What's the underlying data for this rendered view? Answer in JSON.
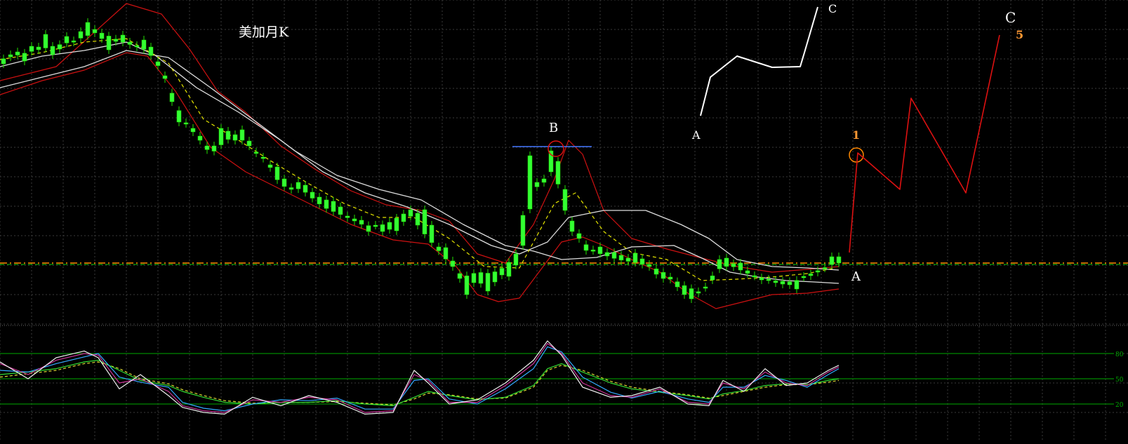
{
  "chart_data": {
    "type": "candlestick",
    "title": "美加月K",
    "grid": true,
    "background": "#000000",
    "colors": {
      "candle": "#22e000",
      "ma_white": "#dddddd",
      "ma_red": "#cc1111",
      "ma_yellow": "#e5e500",
      "bar_up": "#33ff33",
      "grid": "#3a3a3a",
      "ref_orange": "#ff8800",
      "ref_green": "#00cc00",
      "annot_white": "#ffffff",
      "annot_red": "#dd1111",
      "annot_orange": "#ff9933",
      "annot_blue": "#4477ff",
      "osc_white": "#eeeeee",
      "osc_magenta": "#cc3399",
      "osc_cyan": "#33aaff",
      "osc_green": "#33dd33",
      "osc_yellow": "#dddd33"
    },
    "main_panel": {
      "ylim": [
        0,
        470
      ],
      "price_x": [
        0,
        50,
        100,
        140,
        175,
        210,
        235,
        260,
        285,
        300,
        320,
        335,
        355,
        380,
        400,
        430,
        460,
        490,
        520,
        550,
        580,
        610,
        640,
        660,
        680,
        700,
        720,
        745,
        760,
        775,
        790,
        800,
        815,
        830,
        850,
        880,
        910,
        940,
        970,
        1000,
        1020,
        1040,
        1070,
        1100,
        1130,
        1160,
        1190
      ],
      "price_close": [
        385,
        398,
        410,
        425,
        410,
        398,
        362,
        300,
        270,
        250,
        268,
        278,
        262,
        240,
        205,
        200,
        175,
        162,
        148,
        150,
        168,
        130,
        95,
        75,
        82,
        80,
        90,
        120,
        198,
        215,
        230,
        185,
        140,
        125,
        110,
        100,
        95,
        85,
        65,
        52,
        85,
        92,
        78,
        70,
        68,
        82,
        95
      ],
      "yellow_ma_x": [
        0,
        60,
        120,
        180,
        240,
        290,
        340,
        390,
        440,
        490,
        540,
        590,
        640,
        690,
        740,
        790,
        820,
        860,
        900,
        950,
        1000,
        1050,
        1100,
        1150,
        1190
      ],
      "yellow_ma_y": [
        385,
        395,
        410,
        415,
        380,
        300,
        270,
        238,
        208,
        180,
        160,
        160,
        130,
        90,
        88,
        180,
        195,
        140,
        110,
        100,
        70,
        72,
        75,
        80,
        88
      ],
      "white_ma1_x": [
        0,
        60,
        120,
        180,
        240,
        300,
        360,
        420,
        480,
        540,
        600,
        660,
        720,
        760,
        800,
        850,
        900,
        960,
        1000,
        1040,
        1080,
        1120,
        1160,
        1195
      ],
      "white_ma1_y": [
        345,
        360,
        375,
        398,
        388,
        345,
        300,
        255,
        220,
        200,
        185,
        150,
        120,
        112,
        100,
        103,
        118,
        120,
        102,
        82,
        75,
        70,
        68,
        66
      ],
      "white_ma2_x": [
        0,
        60,
        120,
        180,
        220,
        280,
        340,
        400,
        460,
        520,
        580,
        640,
        700,
        740,
        780,
        810,
        860,
        920,
        970,
        1010,
        1050,
        1100,
        1150,
        1195
      ],
      "white_ma2_y": [
        375,
        390,
        398,
        410,
        392,
        345,
        310,
        270,
        225,
        195,
        175,
        150,
        120,
        108,
        125,
        160,
        170,
        170,
        150,
        130,
        100,
        90,
        88,
        85
      ],
      "red_upper_x": [
        0,
        80,
        180,
        230,
        270,
        310,
        350,
        400,
        450,
        500,
        550,
        600,
        640,
        680,
        720,
        760,
        790,
        810,
        830,
        860,
        900,
        950,
        1000,
        1050,
        1100,
        1150,
        1195
      ],
      "red_upper_y": [
        355,
        375,
        465,
        450,
        400,
        340,
        310,
        262,
        228,
        198,
        178,
        170,
        155,
        108,
        95,
        150,
        215,
        270,
        250,
        170,
        130,
        115,
        102,
        90,
        82,
        86,
        90
      ],
      "red_lower_x": [
        0,
        60,
        120,
        180,
        210,
        250,
        300,
        350,
        400,
        450,
        500,
        560,
        610,
        650,
        680,
        710,
        740,
        770,
        800,
        830,
        860,
        900,
        940,
        980,
        1020,
        1060,
        1100,
        1150,
        1195
      ],
      "red_lower_y": [
        335,
        355,
        370,
        395,
        390,
        340,
        260,
        225,
        200,
        175,
        150,
        128,
        122,
        90,
        50,
        40,
        45,
        85,
        125,
        132,
        120,
        100,
        82,
        52,
        30,
        40,
        50,
        52,
        58
      ],
      "up_bars_x": [
        5,
        15,
        25,
        35,
        45,
        55,
        65,
        75,
        85,
        95,
        105,
        115,
        125,
        135,
        145,
        155,
        165,
        175,
        185,
        195,
        205,
        215,
        225,
        235,
        245,
        255,
        265,
        275,
        285,
        295,
        305,
        315,
        325,
        335,
        345,
        355,
        365,
        375,
        385,
        395,
        405,
        415,
        425,
        435,
        445,
        455,
        465,
        475,
        485,
        495,
        505,
        515,
        525,
        535,
        545,
        555,
        565,
        575,
        585,
        595,
        605,
        615,
        625,
        635,
        645,
        655,
        665,
        675,
        685,
        695,
        705,
        715,
        725,
        735,
        745,
        755,
        765,
        775,
        785,
        795,
        805,
        815,
        825,
        835,
        845,
        855,
        865,
        875,
        885,
        895,
        905,
        915,
        925,
        935,
        945,
        955,
        965,
        975,
        985,
        995,
        1005,
        1015,
        1025,
        1035,
        1045,
        1055,
        1065,
        1075,
        1085,
        1095,
        1105,
        1115,
        1125,
        1135,
        1145,
        1155,
        1165,
        1175,
        1185,
        1195
      ],
      "up_bars_value": [
        379,
        392,
        396,
        383,
        404,
        403,
        421,
        392,
        400,
        418,
        410,
        425,
        438,
        428,
        415,
        399,
        411,
        420,
        410,
        405,
        413,
        403,
        382,
        358,
        325,
        296,
        295,
        287,
        276,
        262,
        262,
        287,
        283,
        270,
        285,
        269,
        252,
        246,
        235,
        232,
        215,
        200,
        210,
        206,
        196,
        189,
        185,
        183,
        175,
        162,
        158,
        156,
        140,
        149,
        140,
        143,
        141,
        154,
        171,
        166,
        171,
        149,
        118,
        117,
        98,
        73,
        50,
        67,
        66,
        55,
        68,
        78,
        76,
        92,
        163,
        248,
        210,
        210,
        255,
        240,
        200,
        155,
        137,
        113,
        113,
        118,
        110,
        110,
        106,
        102,
        109,
        101,
        93,
        79,
        73,
        72,
        61,
        50,
        44,
        52,
        61,
        71,
        100,
        102,
        94,
        95,
        84,
        77,
        71,
        72,
        67,
        65,
        64,
        58,
        76,
        77,
        82,
        88,
        104,
        104
      ],
      "orange_level": 95,
      "green_level": 93
    },
    "oscillator_panel": {
      "ylim": [
        0,
        100
      ],
      "ref_levels": [
        {
          "value": 80,
          "label": "80"
        },
        {
          "value": 50,
          "label": "50"
        },
        {
          "value": 20,
          "label": "20"
        }
      ],
      "x": [
        0,
        40,
        80,
        120,
        140,
        170,
        200,
        240,
        260,
        290,
        320,
        360,
        400,
        440,
        480,
        520,
        560,
        590,
        610,
        640,
        680,
        720,
        760,
        780,
        800,
        830,
        870,
        900,
        940,
        980,
        1010,
        1030,
        1060,
        1090,
        1120,
        1150,
        1180,
        1195
      ],
      "white": [
        70,
        50,
        75,
        83,
        75,
        38,
        55,
        30,
        16,
        10,
        8,
        28,
        18,
        30,
        22,
        8,
        10,
        60,
        45,
        20,
        25,
        45,
        72,
        95,
        78,
        40,
        28,
        30,
        40,
        20,
        18,
        48,
        35,
        62,
        42,
        45,
        60,
        66
      ],
      "magenta": [
        68,
        55,
        72,
        80,
        78,
        45,
        50,
        35,
        18,
        12,
        10,
        25,
        22,
        28,
        25,
        10,
        12,
        55,
        48,
        22,
        22,
        42,
        68,
        92,
        80,
        45,
        30,
        28,
        38,
        22,
        20,
        45,
        38,
        58,
        45,
        42,
        58,
        64
      ],
      "cyan": [
        60,
        58,
        68,
        76,
        80,
        52,
        46,
        40,
        22,
        15,
        12,
        20,
        25,
        24,
        27,
        14,
        14,
        48,
        50,
        26,
        20,
        38,
        62,
        88,
        82,
        52,
        34,
        27,
        35,
        26,
        22,
        40,
        40,
        54,
        48,
        40,
        55,
        62
      ],
      "green": [
        55,
        58,
        62,
        70,
        72,
        60,
        48,
        42,
        35,
        28,
        22,
        20,
        22,
        22,
        24,
        20,
        18,
        28,
        35,
        30,
        25,
        28,
        42,
        62,
        68,
        58,
        45,
        38,
        34,
        30,
        26,
        32,
        36,
        42,
        44,
        43,
        48,
        50
      ],
      "yellow": [
        52,
        56,
        60,
        68,
        70,
        62,
        50,
        44,
        37,
        30,
        24,
        21,
        22,
        22,
        23,
        21,
        19,
        26,
        33,
        31,
        26,
        27,
        40,
        60,
        66,
        60,
        47,
        40,
        35,
        31,
        27,
        30,
        35,
        40,
        43,
        43,
        46,
        48
      ]
    },
    "annotations": {
      "title_text": "美加月K",
      "label_B": "B",
      "label_A_white_path": "A",
      "label_C_white_path": "C",
      "label_C_red_path": "C",
      "label_A_end": "A",
      "label_1": "1",
      "label_5": "5",
      "white_path_x": [
        998,
        1012,
        1050,
        1100,
        1140,
        1146,
        1165
      ],
      "white_path_y": [
        305,
        360,
        390,
        374,
        375,
        395,
        460
      ],
      "red_path_x": [
        1210,
        1222,
        1282,
        1298,
        1376,
        1424
      ],
      "red_path_y": [
        110,
        252,
        200,
        330,
        195,
        420
      ]
    }
  }
}
